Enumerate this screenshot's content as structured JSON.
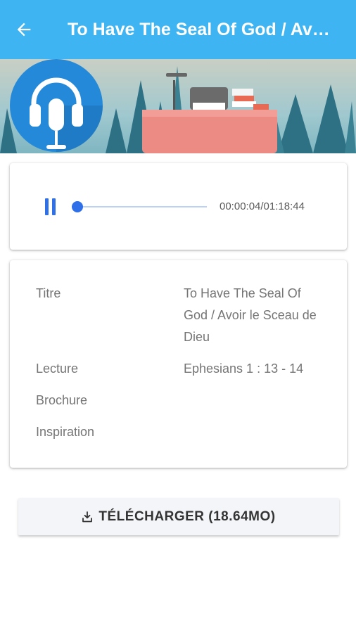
{
  "app_bar": {
    "title": "To Have The Seal Of God / Avoir le Sceau de Dieu",
    "background": "#3fb4f2"
  },
  "player": {
    "state": "playing",
    "progress": 0.001,
    "time_display": "00:00:04/01:18:44",
    "accent": "#2f6fe8"
  },
  "details": {
    "rows": [
      {
        "label": "Titre",
        "value": "To Have The Seal Of God / Avoir le Sceau de Dieu"
      },
      {
        "label": "Lecture",
        "value": "Ephesians 1 : 13 - 14"
      },
      {
        "label": "Brochure",
        "value": ""
      },
      {
        "label": "Inspiration",
        "value": ""
      }
    ]
  },
  "download": {
    "label": "TÉLÉCHARGER (18.64MO)",
    "icon": "download-icon"
  },
  "icons": {
    "back": "arrow-left-icon",
    "podcast": "headphones-microphone-icon",
    "pause": "pause-icon"
  }
}
